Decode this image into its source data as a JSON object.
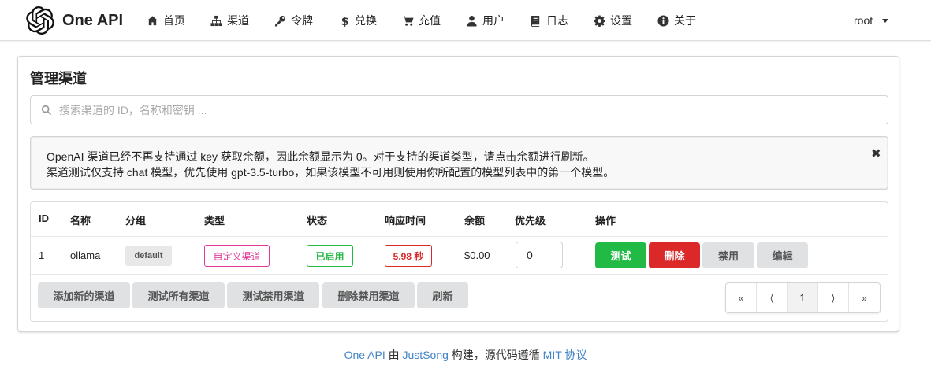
{
  "app": {
    "name": "One API"
  },
  "nav": [
    {
      "label": "首页",
      "icon": "home-icon"
    },
    {
      "label": "渠道",
      "icon": "sitemap-icon"
    },
    {
      "label": "令牌",
      "icon": "key-icon"
    },
    {
      "label": "兑换",
      "icon": "dollar-icon"
    },
    {
      "label": "充值",
      "icon": "cart-icon"
    },
    {
      "label": "用户",
      "icon": "user-icon"
    },
    {
      "label": "日志",
      "icon": "book-icon"
    },
    {
      "label": "设置",
      "icon": "gear-icon"
    },
    {
      "label": "关于",
      "icon": "info-icon"
    }
  ],
  "user": {
    "name": "root"
  },
  "page": {
    "title": "管理渠道",
    "search_placeholder": "搜索渠道的 ID，名称和密钥 ...",
    "notice": {
      "line1": "OpenAI 渠道已经不再支持通过 key 获取余额，因此余额显示为 0。对于支持的渠道类型，请点击余额进行刷新。",
      "line2": "渠道测试仅支持 chat 模型，优先使用 gpt-3.5-turbo，如果该模型不可用则使用你所配置的模型列表中的第一个模型。",
      "close": "✖"
    }
  },
  "table": {
    "headers": [
      "ID",
      "名称",
      "分组",
      "类型",
      "状态",
      "响应时间",
      "余额",
      "优先级",
      "操作"
    ],
    "rows": [
      {
        "id": "1",
        "name": "ollama",
        "group": "default",
        "type": "自定义渠道",
        "status": "已启用",
        "response_time": "5.98 秒",
        "balance": "$0.00",
        "priority": "0",
        "actions": {
          "test": "测试",
          "delete": "删除",
          "disable": "禁用",
          "edit": "编辑"
        }
      }
    ]
  },
  "bottom_actions": {
    "add": "添加新的渠道",
    "test_all": "测试所有渠道",
    "test_disabled": "测试禁用渠道",
    "delete_disabled": "删除禁用渠道",
    "refresh": "刷新"
  },
  "pagination": {
    "first": "«",
    "prev": "⟨",
    "current": "1",
    "next": "⟩",
    "last": "»"
  },
  "footer": {
    "app": "One API",
    "by": " 由 ",
    "author": "JustSong",
    "mid": " 构建，源代码遵循 ",
    "license": "MIT 协议"
  },
  "colors": {
    "green": "#21ba45",
    "red": "#db2828",
    "pink": "#e03997",
    "link": "#4183c4"
  }
}
